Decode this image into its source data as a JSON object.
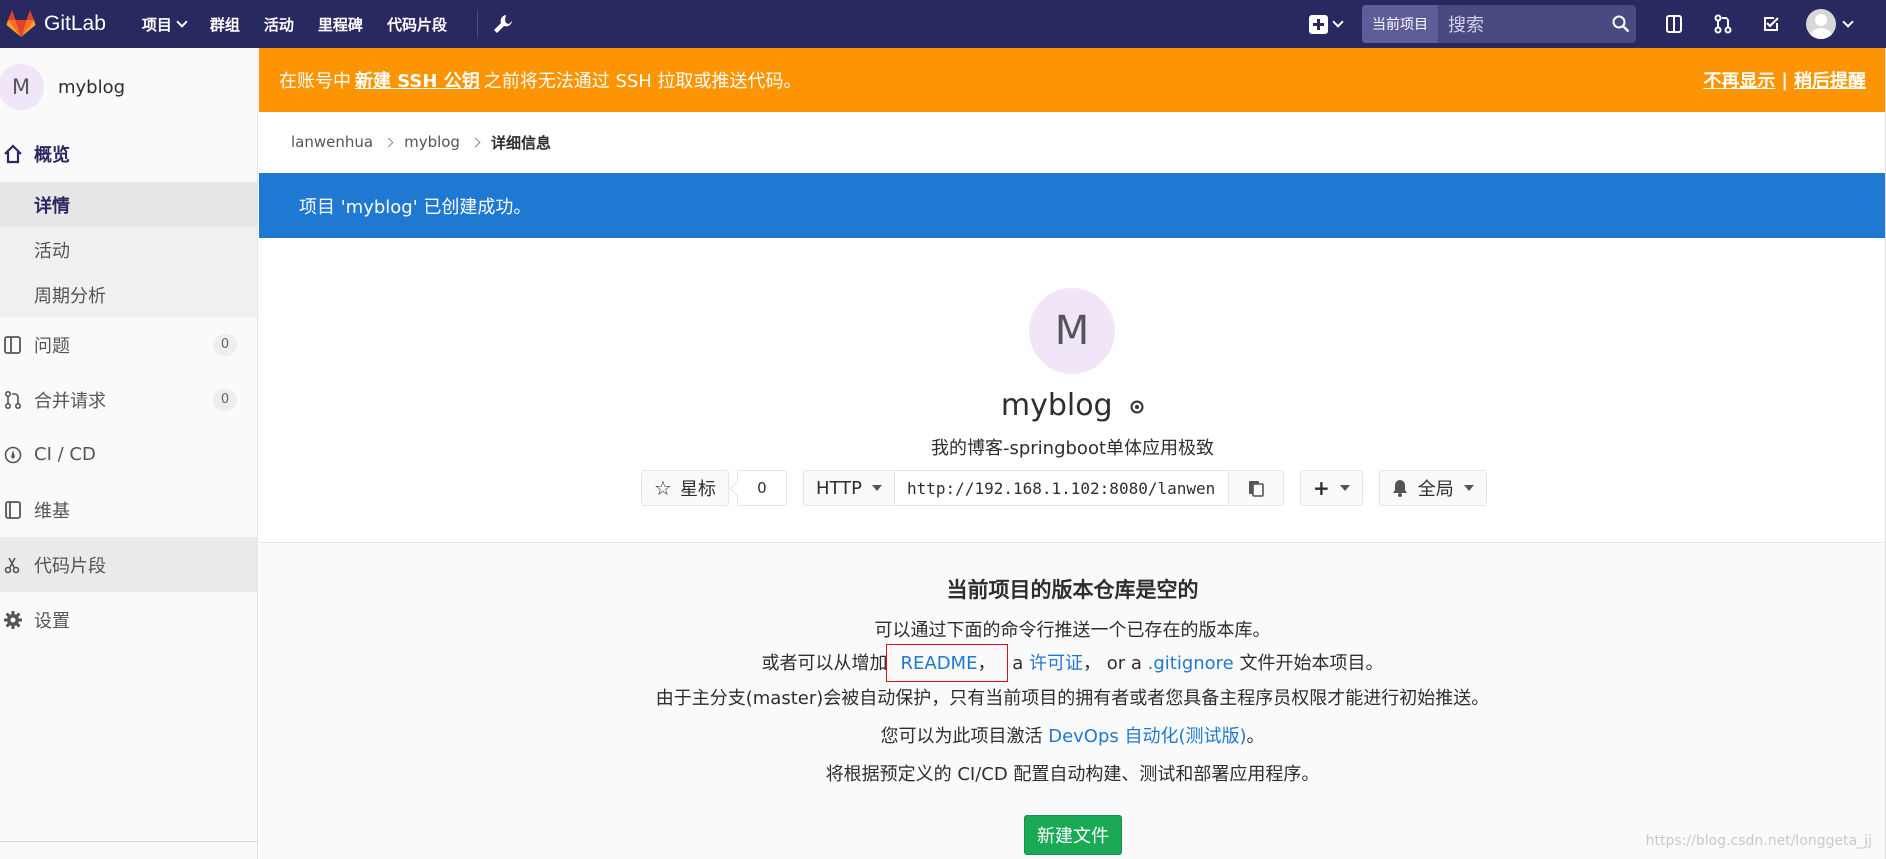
{
  "topnav": {
    "brand": "GitLab",
    "links": [
      "项目",
      "群组",
      "活动",
      "里程碑",
      "代码片段"
    ],
    "search_scope": "当前项目",
    "search_placeholder": "搜索"
  },
  "sidebar": {
    "project_avatar": "M",
    "project_name": "myblog",
    "overview": "概览",
    "sub_items": [
      "详情",
      "活动",
      "周期分析"
    ],
    "items": [
      {
        "label": "问题",
        "count": "0",
        "icon": "issues-icon"
      },
      {
        "label": "合并请求",
        "count": "0",
        "icon": "merge-request-icon"
      },
      {
        "label": "CI / CD",
        "icon": "rocket-icon"
      },
      {
        "label": "维基",
        "icon": "book-icon"
      },
      {
        "label": "代码片段",
        "icon": "scissors-icon"
      },
      {
        "label": "设置",
        "icon": "gear-icon"
      }
    ]
  },
  "alert": {
    "prefix": "在账号中",
    "link": "新建 SSH 公钥",
    "suffix": "之前将无法通过 SSH 拉取或推送代码。",
    "dismiss": "不再显示",
    "separator": "|",
    "remind": "稍后提醒"
  },
  "breadcrumb": [
    "lanwenhua",
    "myblog",
    "详细信息"
  ],
  "flash": "项目 'myblog' 已创建成功。",
  "project": {
    "avatar": "M",
    "name": "myblog",
    "description": "我的博客-springboot单体应用极致",
    "star_label": "星标",
    "star_count": "0",
    "protocol": "HTTP",
    "clone_url": "http://192.168.1.102:8080/lanwen",
    "notification": "全局"
  },
  "empty_repo": {
    "title": "当前项目的版本仓库是空的",
    "line1": "可以通过下面的命令行推送一个已存在的版本库。",
    "line2_prefix": "或者可以从增加",
    "readme": "README",
    "comma1": "，",
    "a_word": "a",
    "license": "许可证",
    "comma2": "，",
    "or_a": "or a",
    "gitignore": ".gitignore",
    "line2_suffix": "文件开始本项目。",
    "line3": "由于主分支(master)会被自动保护，只有当前项目的拥有者或者您具备主程序员权限才能进行初始推送。",
    "line4_prefix": "您可以为此项目激活",
    "devops": "DevOps 自动化(测试版)",
    "line4_suffix": "。",
    "line5": "将根据预定义的 CI/CD 配置自动构建、测试和部署应用程序。",
    "new_file": "新建文件"
  },
  "watermark": "https://blog.csdn.net/longgeta_jj",
  "colors": {
    "navbar": "#292961",
    "alert": "#fc9403",
    "flash": "#1f78d1",
    "link": "#1f78d1",
    "success": "#1aaa55",
    "highlight_box": "#e0101a"
  }
}
